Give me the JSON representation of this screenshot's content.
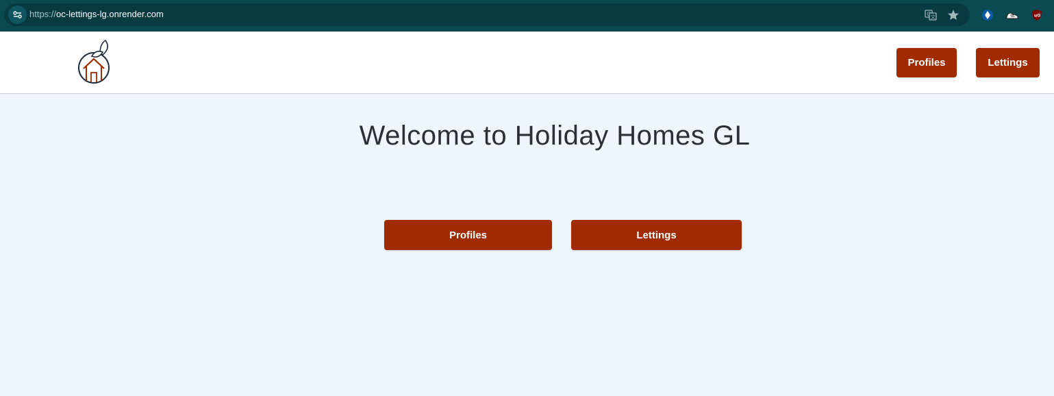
{
  "browser": {
    "url_scheme": "https://",
    "url_host": "oc-lettings-lg.onrender.com",
    "icons": {
      "site_info": "tune-icon",
      "translate": "translate-icon",
      "bookmark": "star-icon",
      "extension_1": "blue-diamond-icon",
      "extension_2": "sneaker-icon",
      "extension_3": "ublock-origin-icon"
    },
    "colors": {
      "toolbar": "#0c4a52",
      "omnibox": "#083a41"
    }
  },
  "header": {
    "logo_icon": "orange-house-logo",
    "nav": {
      "profiles_label": "Profiles",
      "lettings_label": "Lettings"
    }
  },
  "main": {
    "title": "Welcome to Holiday Homes GL",
    "buttons": {
      "profiles_label": "Profiles",
      "lettings_label": "Lettings"
    }
  },
  "colors": {
    "accent": "#a12b00",
    "page_background": "#f0f4fb",
    "header_background": "#ffffff"
  }
}
